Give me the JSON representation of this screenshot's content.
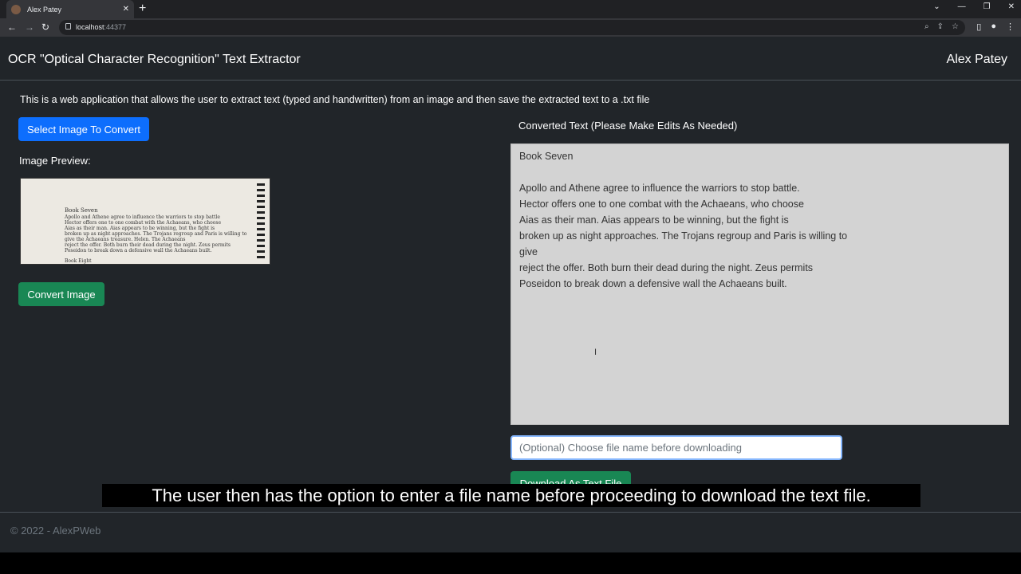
{
  "browser": {
    "tab_title": "Alex Patey",
    "tab_close": "✕",
    "new_tab": "+",
    "url_host": "localhost",
    "url_port": ":44377"
  },
  "navbar": {
    "brand": "OCR \"Optical Character Recognition\" Text Extractor",
    "user": "Alex Patey"
  },
  "main": {
    "intro": "This is a web application that allows the user to extract text (typed and handwritten) from an image and then save the extracted text to a .txt file",
    "select_button": "Select Image To Convert",
    "preview_label": "Image Preview:",
    "convert_button": "Convert Image",
    "converted_label": "Converted Text (Please Make Edits As Needed)",
    "converted_text": "Book Seven\n\nApollo and Athene agree to influence the warriors to stop battle.\nHector offers one to one combat with the Achaeans, who choose\nAias as their man. Aias appears to be winning, but the fight is\nbroken up as night approaches. The Trojans regroup and Paris is willing to\ngive\nreject the offer. Both burn their dead during the night. Zeus permits\nPoseidon to break down a defensive wall the Achaeans built.",
    "filename_placeholder": "(Optional) Choose file name before downloading",
    "download_button": "Download As Text File"
  },
  "preview_image": {
    "lines": [
      "Book Seven",
      "Apollo and Athene agree to influence the warriors to stop battle",
      "Hector offers one to one combat with the Achaeans, who choose",
      "Aias as their man. Aias appears to be winning, but the fight is",
      "broken up as night approaches. The Trojans regroup and Paris is willing to",
      "give the Achaeans treasure. Helen. The Achaeans",
      "reject the offer. Both burn their dead during the night. Zeus permits",
      "Poseidon to break down a defensive wall the Achaeans built.",
      "Book Eight"
    ]
  },
  "footer": {
    "text": "© 2022 - AlexPWeb"
  },
  "caption": "The user then has the option to enter a file name before proceeding to download the text file."
}
